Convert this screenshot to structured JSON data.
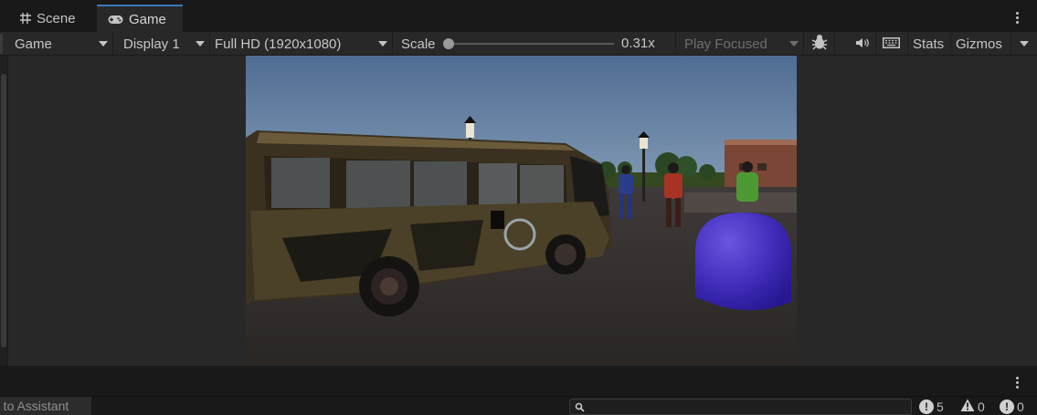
{
  "tabs": [
    {
      "label": "Scene",
      "icon": "grid-icon"
    },
    {
      "label": "Game",
      "icon": "gamepad-icon",
      "active": true
    }
  ],
  "toolbar": {
    "view_mode": "Game",
    "display": "Display 1",
    "resolution": "Full HD (1920x1080)",
    "scale_label": "Scale",
    "scale_value": "0.31x",
    "scale_fraction": 0.0,
    "play_mode": "Play Focused",
    "stats_label": "Stats",
    "gizmos_label": "Gizmos"
  },
  "statusbar": {
    "assistant_text": "d to Assistant",
    "search_placeholder": "",
    "errors_count": "5",
    "warnings_count": "0",
    "info_count": "0"
  },
  "colors": {
    "accent": "#3a79bb",
    "panel": "#282828",
    "background": "#191919"
  }
}
